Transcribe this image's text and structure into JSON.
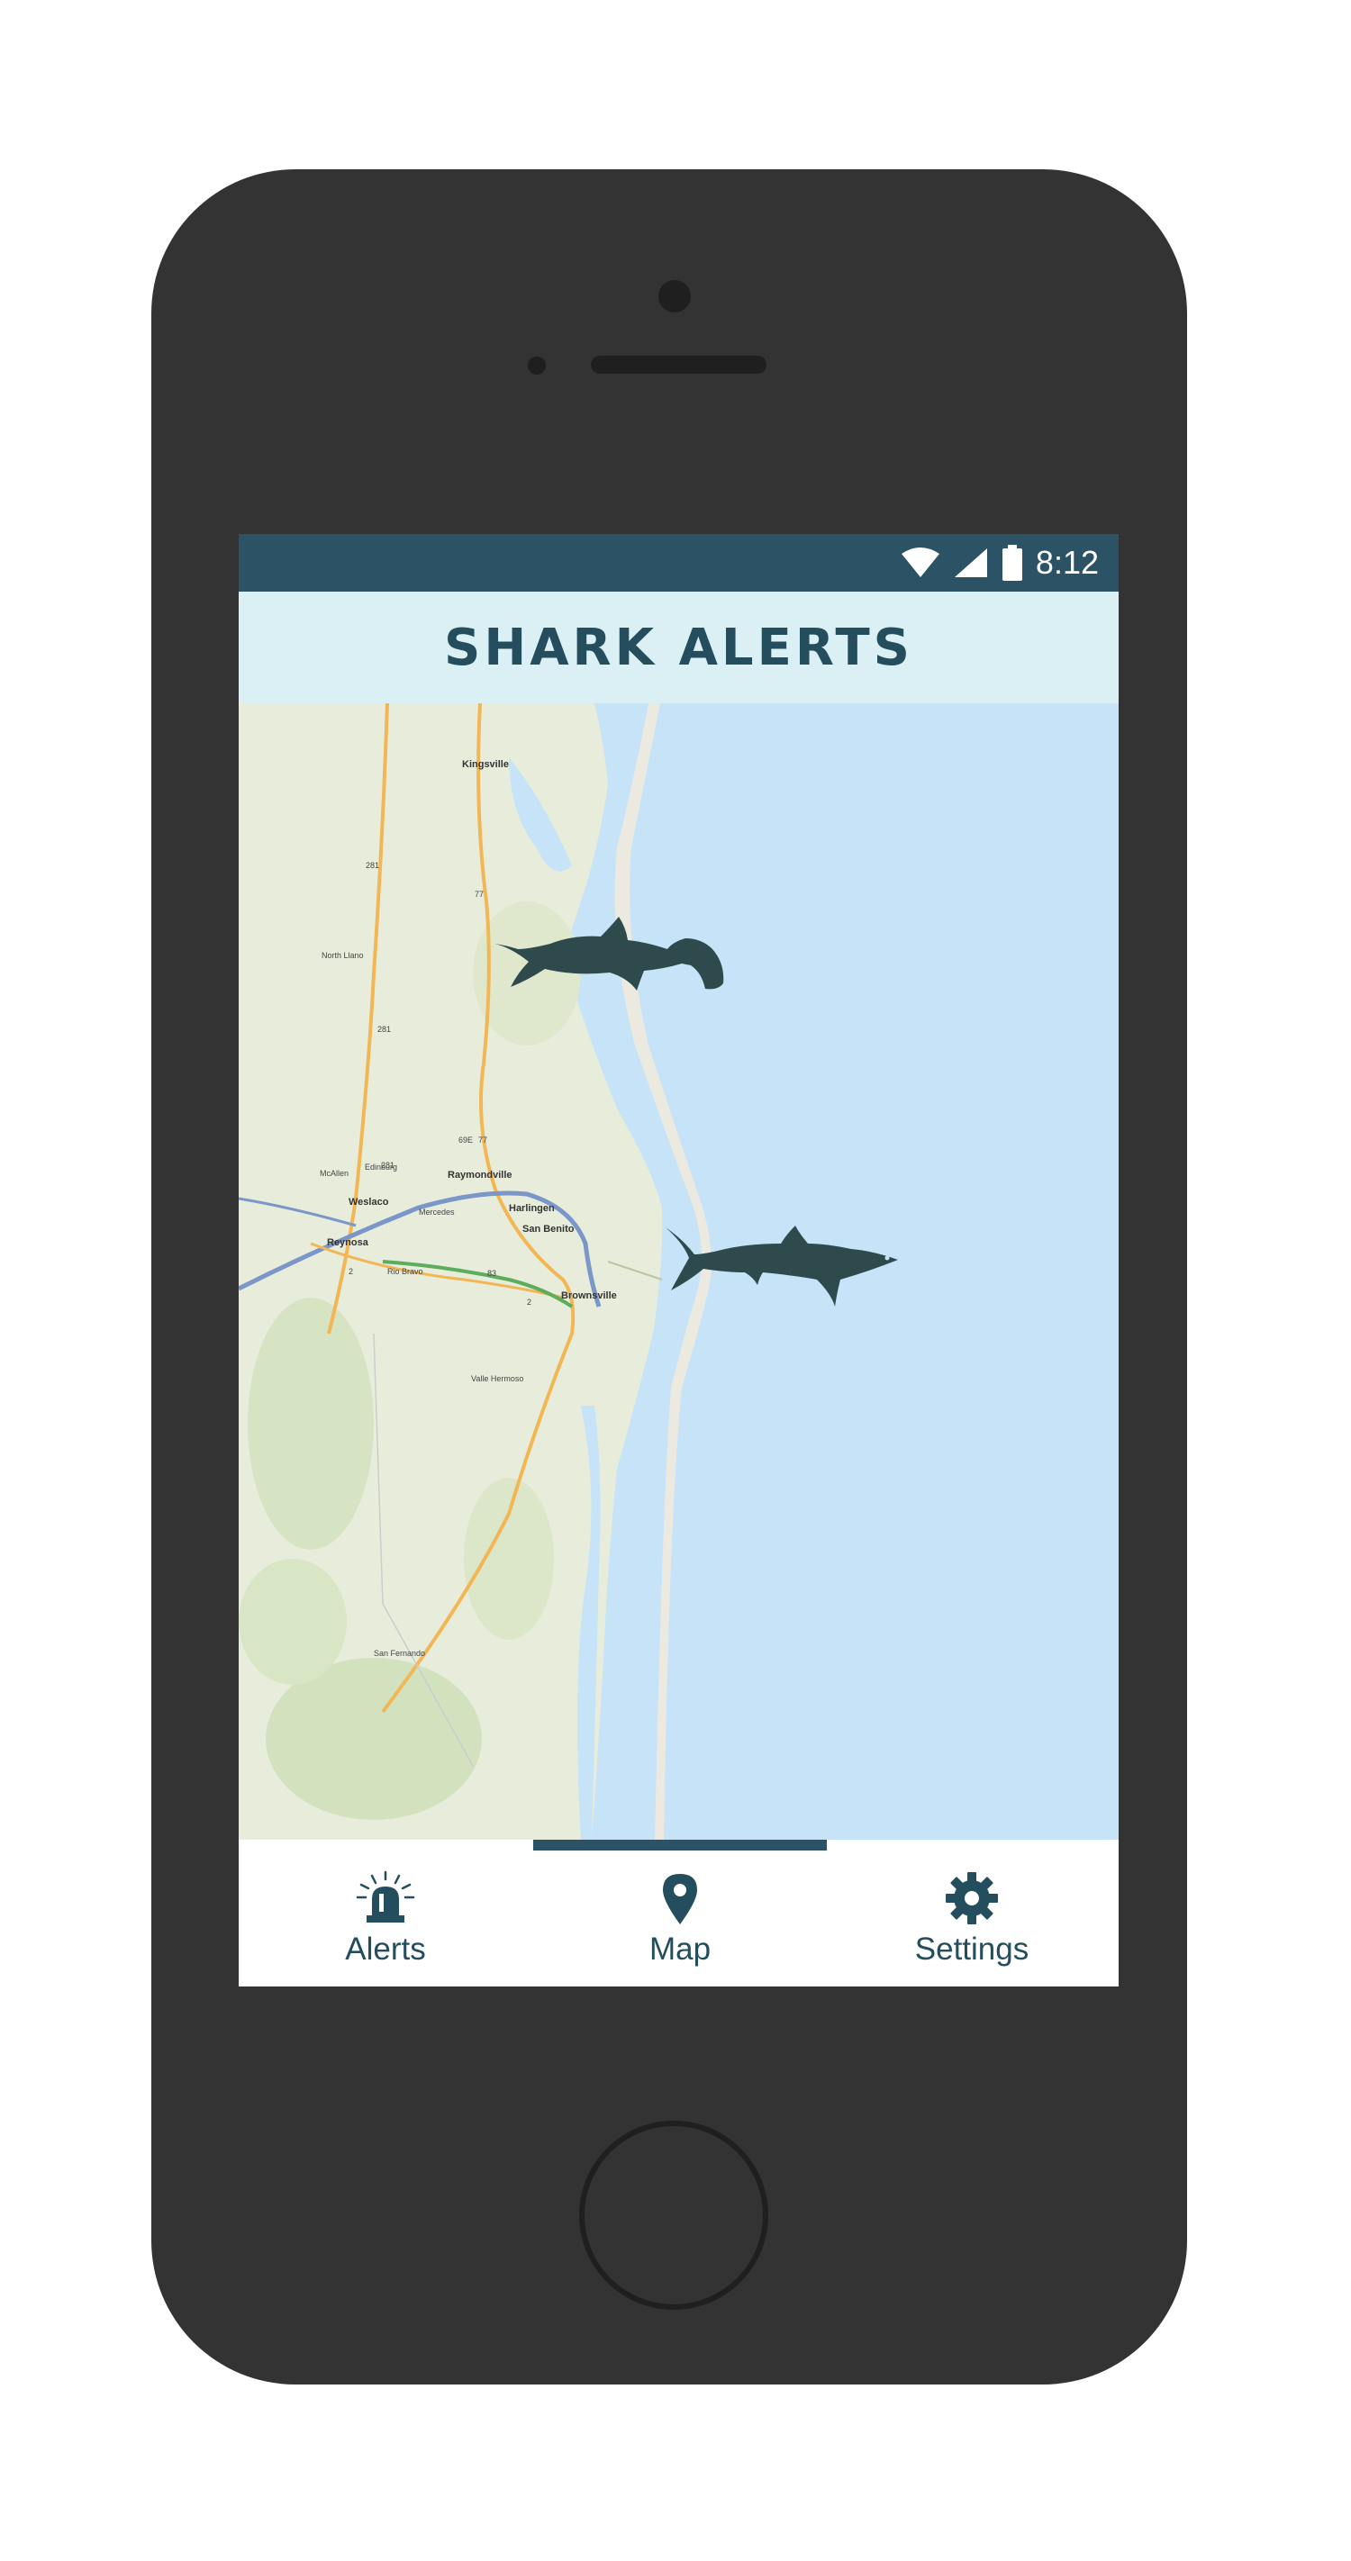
{
  "status_bar": {
    "time": "8:12",
    "icons": [
      "wifi-icon",
      "signal-icon",
      "battery-icon"
    ]
  },
  "header": {
    "title": "Shark Alerts"
  },
  "map": {
    "cities": [
      "Kingsville",
      "Raymondville",
      "Weslaco",
      "Harlingen",
      "San Benito",
      "Reynosa",
      "Rio Bravo",
      "Brownsville",
      "McAllen",
      "Edinburg",
      "Mercedes",
      "Valle Hermoso",
      "San Fernando",
      "North Llano"
    ],
    "route_labels": [
      "281",
      "77",
      "281",
      "69E",
      "77",
      "281",
      "83",
      "2",
      "2"
    ],
    "markers": [
      {
        "type": "hammerhead-shark",
        "icon": "hammerhead-shark-icon"
      },
      {
        "type": "shark",
        "icon": "shark-icon"
      }
    ]
  },
  "bottom_nav": {
    "active": "Map",
    "items": [
      {
        "label": "Alerts",
        "icon": "siren-icon"
      },
      {
        "label": "Map",
        "icon": "map-pin-icon"
      },
      {
        "label": "Settings",
        "icon": "gear-icon"
      }
    ]
  },
  "colors": {
    "status_bar": "#2c5365",
    "header_bg": "#daf0f5",
    "accent": "#244e5e",
    "water": "#c6e3f8",
    "land": "#e6ecd6",
    "shark": "#2f4a4c",
    "phone_body": "#333333"
  }
}
